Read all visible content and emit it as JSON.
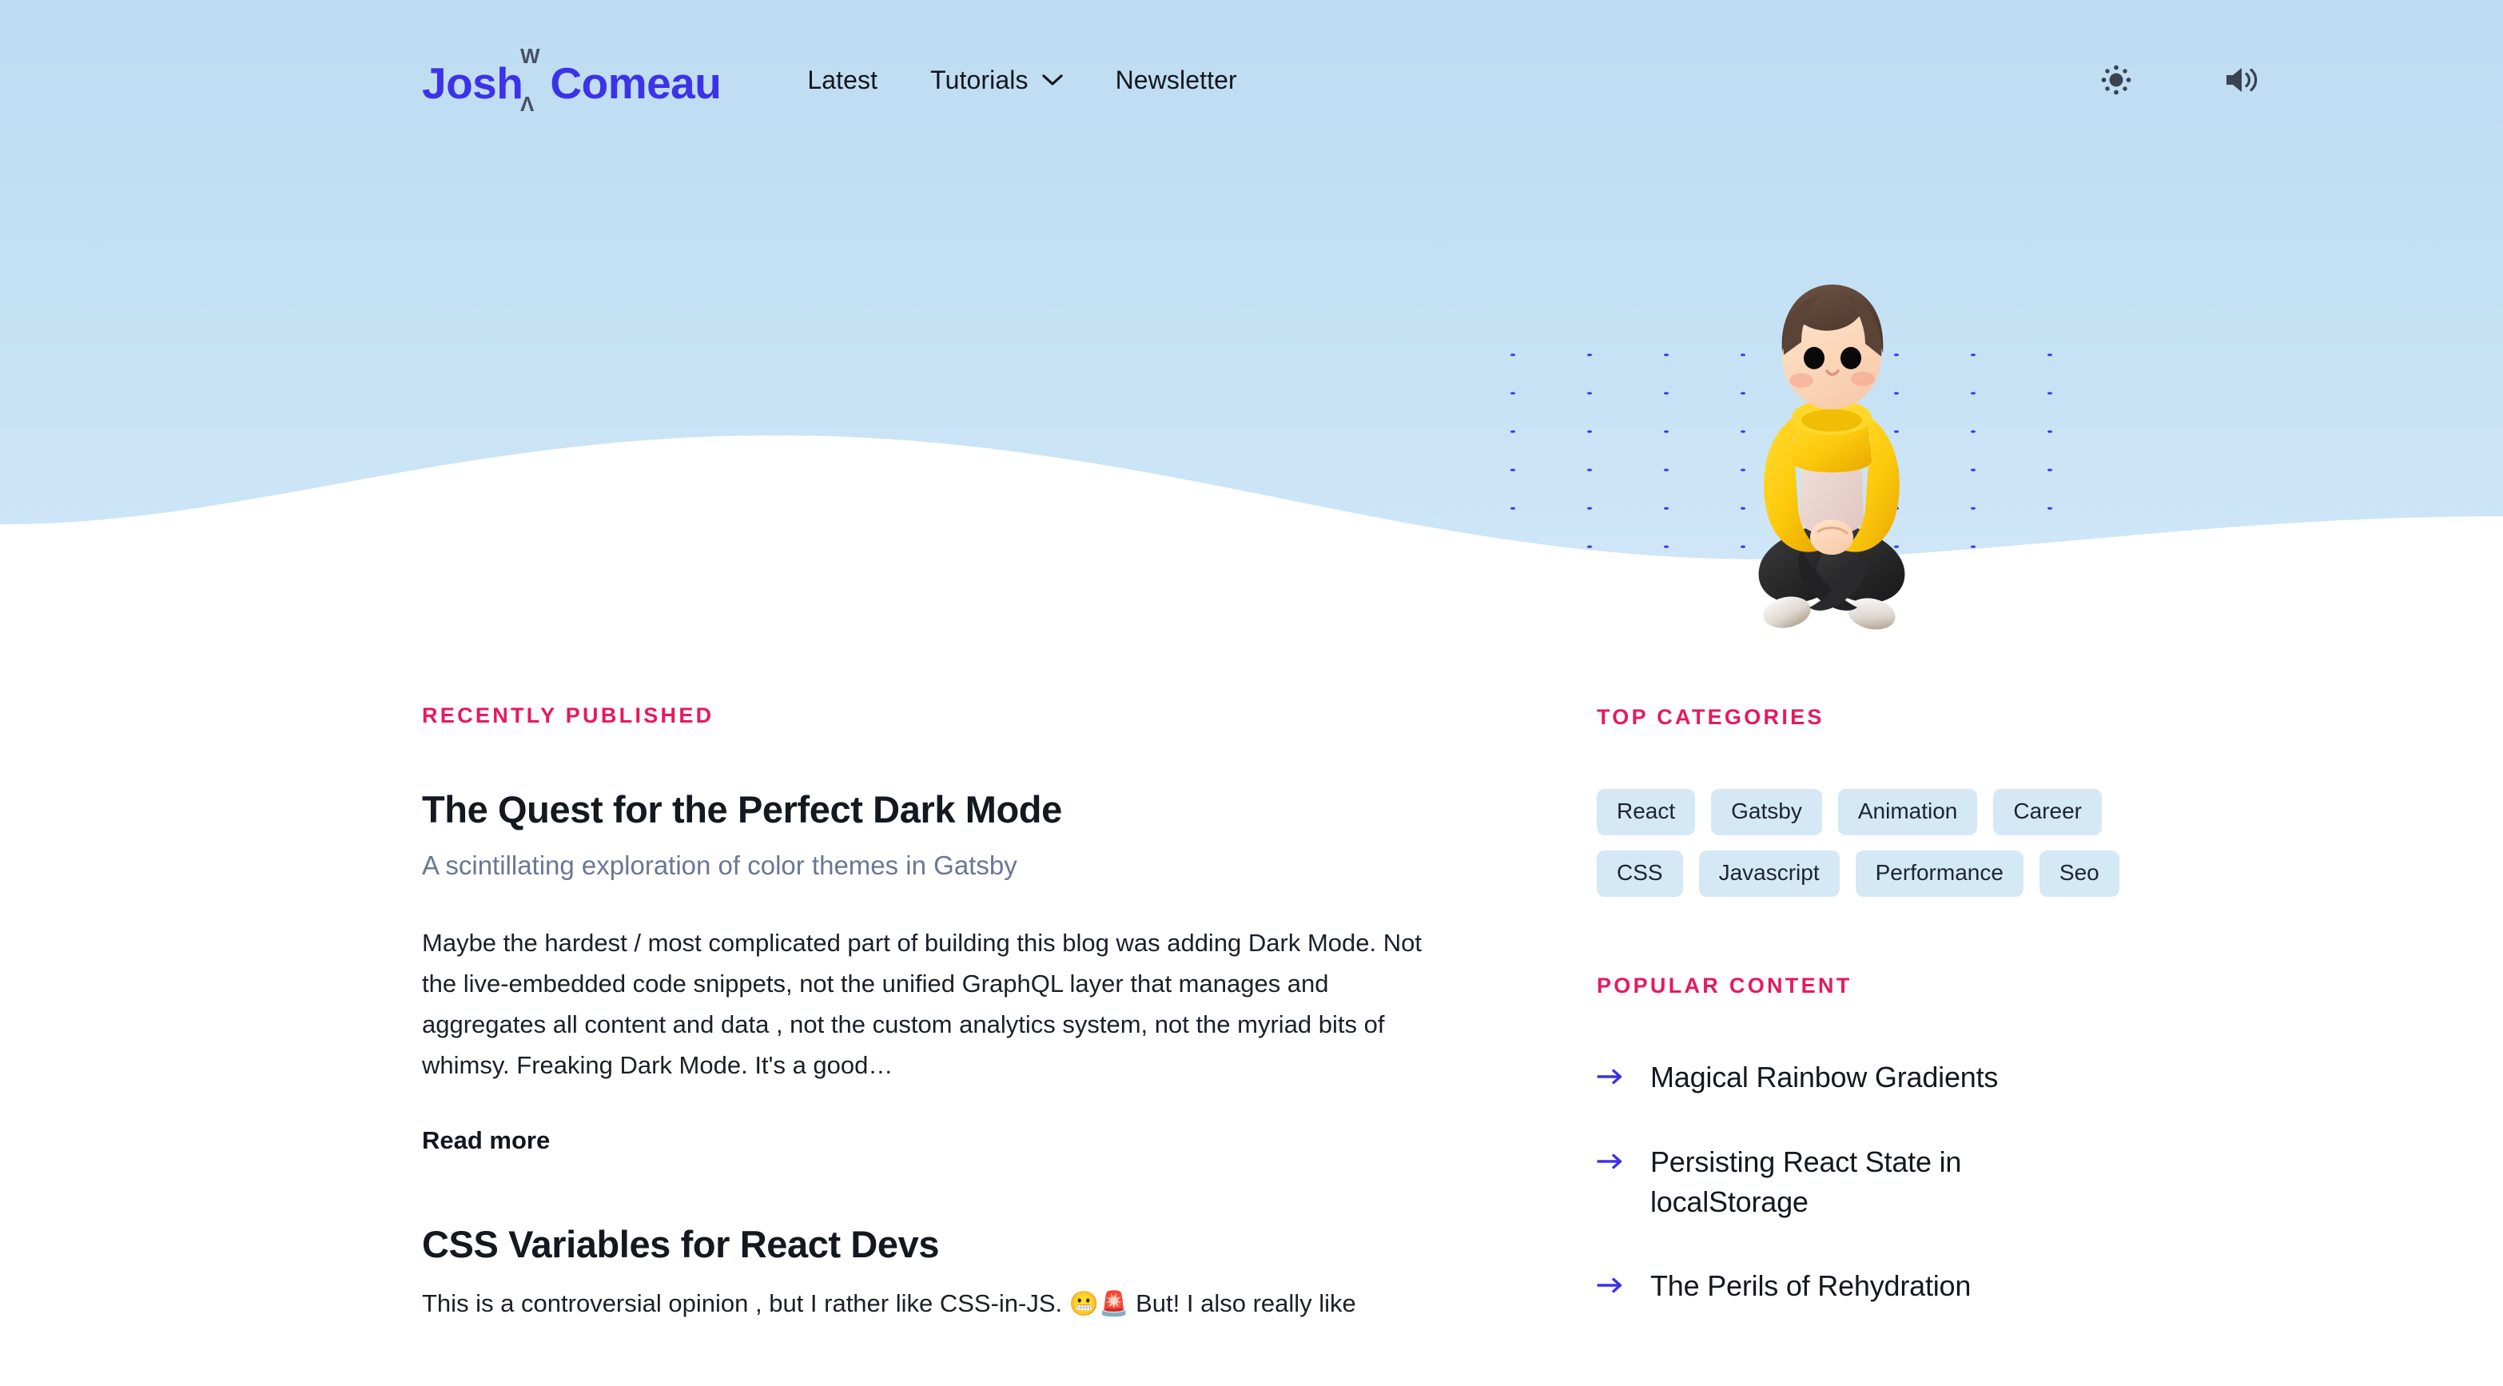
{
  "site": {
    "logo_first": "Josh",
    "logo_second": "Comeau",
    "logo_mark_top": "W",
    "logo_mark_bottom": "Λ"
  },
  "header": {
    "nav": [
      {
        "label": "Latest",
        "has_dropdown": false,
        "icon": ""
      },
      {
        "label": "Tutorials",
        "has_dropdown": true,
        "icon": "chevron-down-icon"
      },
      {
        "label": "Newsletter",
        "has_dropdown": false,
        "icon": ""
      }
    ],
    "actions": [
      {
        "name": "light-mode-toggle",
        "icon": "sun-icon"
      },
      {
        "name": "sound-toggle",
        "icon": "speaker-icon"
      }
    ]
  },
  "hero": {
    "illustration": "sitting-character-illustration",
    "background_top": "#bedcf2",
    "background_bottom": "#d1e8f8",
    "dot_color": "#3a35f0"
  },
  "main": {
    "section_label": "RECENTLY PUBLISHED",
    "posts": [
      {
        "title": "The Quest for the Perfect Dark Mode",
        "subtitle": "A scintillating exploration of color themes in Gatsby",
        "excerpt": "Maybe the hardest / most complicated part of building this blog was adding Dark Mode. Not the live-embedded code snippets, not the unified GraphQL layer that manages and aggregates all content and data , not the custom analytics system, not the myriad bits of whimsy. Freaking Dark Mode. It's a good…",
        "read_more": "Read more"
      },
      {
        "title": "CSS Variables for React Devs",
        "excerpt_prefix": "This is a controversial opinion , but I rather like CSS-in-JS. ",
        "excerpt_emoji_1": "😬",
        "excerpt_emoji_2": "🚨",
        "excerpt_suffix": " But! I also really like"
      }
    ]
  },
  "sidebar": {
    "categories_label": "TOP CATEGORIES",
    "categories": [
      "React",
      "Gatsby",
      "Animation",
      "Career",
      "CSS",
      "Javascript",
      "Performance",
      "Seo"
    ],
    "popular_label": "POPULAR CONTENT",
    "popular": [
      {
        "title": "Magical Rainbow Gradients",
        "icon": "arrow-right-icon"
      },
      {
        "title": "Persisting React State in localStorage",
        "icon": "arrow-right-icon"
      },
      {
        "title": "The Perils of Rehydration",
        "icon": "arrow-right-icon"
      }
    ]
  },
  "colors": {
    "accent_pink": "#e8185f",
    "brand_indigo": "#3c32e8",
    "tag_bg": "#d4e8f5",
    "text_dark": "#14181f",
    "text_muted": "#6d7694"
  }
}
